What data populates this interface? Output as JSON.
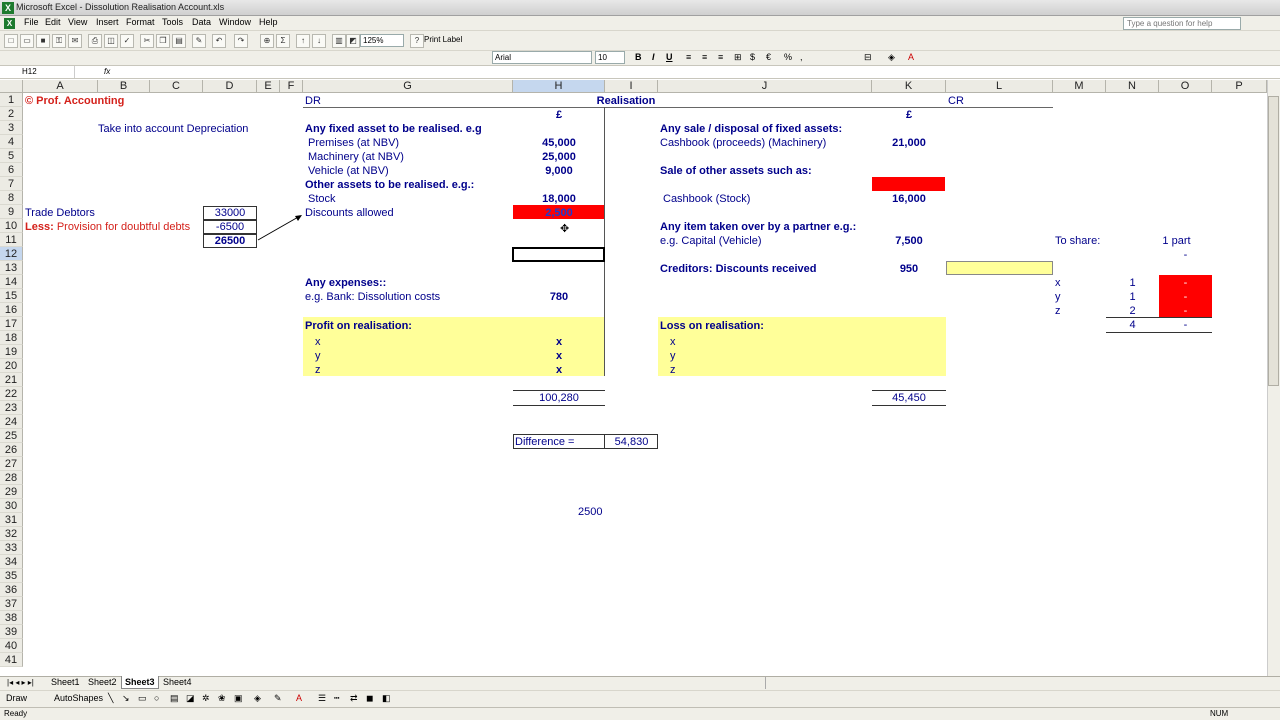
{
  "window": {
    "title": "Microsoft Excel - Dissolution Realisation Account.xls"
  },
  "menu": [
    "File",
    "Edit",
    "View",
    "Insert",
    "Format",
    "Tools",
    "Data",
    "Window",
    "Help"
  ],
  "help_placeholder": "Type a question for help",
  "toolbar": {
    "zoom": "125%",
    "print_label": "Print Label",
    "font": "Arial",
    "font_size": "10",
    "bold": "B",
    "italic": "I",
    "underline": "U"
  },
  "formula_bar": {
    "name_box": "H12",
    "fx": "fx",
    "content": ""
  },
  "columns": [
    "A",
    "B",
    "C",
    "D",
    "E",
    "F",
    "G",
    "H",
    "I",
    "J",
    "K",
    "L",
    "M",
    "N",
    "O",
    "P"
  ],
  "rows": [
    "1",
    "2",
    "3",
    "4",
    "5",
    "6",
    "7",
    "8",
    "9",
    "10",
    "11",
    "12",
    "13",
    "14",
    "15",
    "16",
    "17",
    "18",
    "19",
    "20",
    "21",
    "22",
    "23",
    "24",
    "25",
    "26",
    "27",
    "28",
    "29",
    "30",
    "31",
    "32",
    "33",
    "34",
    "35",
    "36",
    "37",
    "38",
    "39",
    "40",
    "41"
  ],
  "cells": {
    "A1": "© Prof. Accounting",
    "B3": "Take into account Depreciation",
    "G1": "DR",
    "H1": "Realisation",
    "L1": "CR",
    "H2": "£",
    "K2": "£",
    "G3": "Any fixed asset to be realised. e.g",
    "G4": "Premises (at NBV)",
    "H4": "45,000",
    "G5": "Machinery (at NBV)",
    "H5": "25,000",
    "G6": "Vehicle (at NBV)",
    "H6": "9,000",
    "G7": "Other assets to be realised. e.g.:",
    "G8": "Stock",
    "H8": "18,000",
    "G9": "Discounts allowed",
    "H9": "2,500",
    "A9": "Trade Debtors",
    "D9": "33000",
    "A10_bold": "Less:",
    "A10": "Provision for doubtful debts",
    "D10": "-6500",
    "D11": "26500",
    "G14": "Any expenses::",
    "G15": "e.g. Bank: Dissolution costs",
    "H15": "780",
    "G17": "Profit on realisation:",
    "G18": "x",
    "H18": "x",
    "G19": "y",
    "H19": "x",
    "G20": "z",
    "H20": "x",
    "H22": "100,280",
    "J3": "Any sale / disposal of fixed assets:",
    "J4": "Cashbook (proceeds) (Machinery)",
    "K4": "21,000",
    "J6": "Sale of other assets such as:",
    "J8": "Cashbook (Stock)",
    "K8": "16,000",
    "J10": "Any item taken over by a partner e.g.:",
    "J11": "e.g. Capital (Vehicle)",
    "K11": "7,500",
    "J13": "Creditors: Discounts received",
    "K13": "950",
    "J17": "Loss on realisation:",
    "J18": "x",
    "J19": "y",
    "J20": "z",
    "K22": "45,450",
    "H25": "Difference =",
    "I25": "54,830",
    "H30": "2500",
    "M11": "To share:",
    "O11": "1 part",
    "O12": "-",
    "M14": "x",
    "N14": "1",
    "O14": "-",
    "M15": "y",
    "N15": "1",
    "O15": "-",
    "M16": "z",
    "N16": "2",
    "O16": "-",
    "N17": "4",
    "O17": "-"
  },
  "sheets": [
    "Sheet1",
    "Sheet2",
    "Sheet3",
    "Sheet4"
  ],
  "active_sheet": "Sheet3",
  "drawing_toolbar": {
    "draw": "Draw",
    "autoshapes": "AutoShapes"
  },
  "status": {
    "left": "Ready",
    "right": "NUM"
  },
  "colors": {
    "text_blue": "#00008b",
    "red_text": "#d4211b",
    "fill_yellow": "#ffff99",
    "fill_red": "#ff0000",
    "selection": "#c5d7ee"
  }
}
